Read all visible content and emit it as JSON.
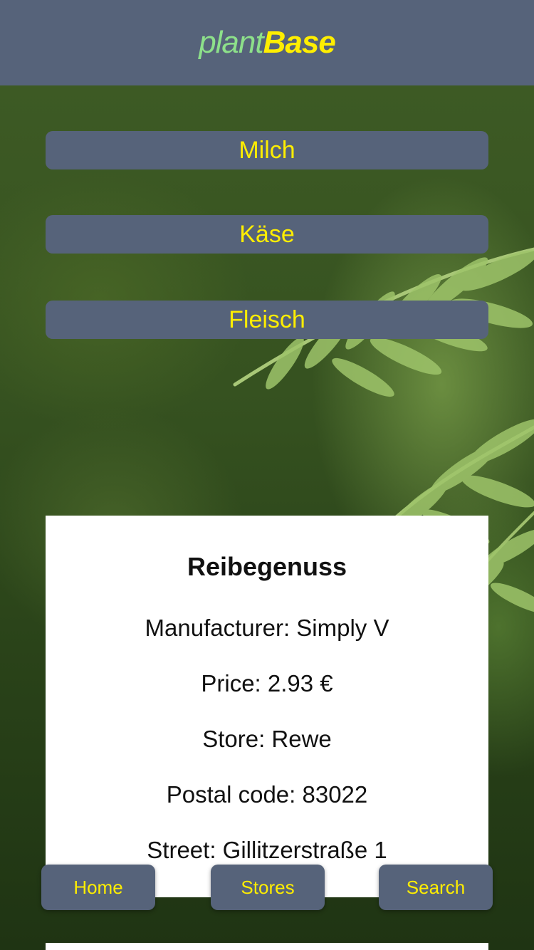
{
  "header": {
    "logo_part1": "plant",
    "logo_part2": "Base"
  },
  "categories": [
    {
      "label": "Milch"
    },
    {
      "label": "Käse"
    },
    {
      "label": "Fleisch"
    }
  ],
  "product": {
    "name": "Reibegenuss",
    "manufacturer": "Manufacturer: Simply V",
    "price": "Price: 2.93 €",
    "store": "Store: Rewe",
    "postal_code": "Postal code: 83022",
    "street": "Street: Gillitzerstraße 1"
  },
  "nav": {
    "home": "Home",
    "stores": "Stores",
    "search": "Search"
  },
  "colors": {
    "header_bg": "#56637a",
    "accent_yellow": "#ffee00",
    "logo_green": "#8de08a"
  }
}
